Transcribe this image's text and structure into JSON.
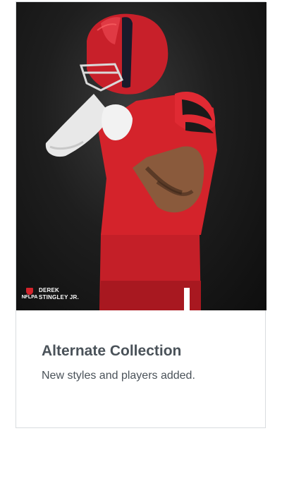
{
  "card": {
    "image": {
      "alt_subject": "football-player-photo",
      "colors": {
        "background": "#1a1a1a",
        "jersey": "#d4232b",
        "helmet": "#c8202a",
        "sleeve": "#e8e8e8"
      }
    },
    "player_tag": {
      "logo_text": "NFLPA",
      "name_line1": "DEREK",
      "name_line2": "STINGLEY JR."
    },
    "title": "Alternate Collection",
    "subtitle": "New styles and players added."
  }
}
